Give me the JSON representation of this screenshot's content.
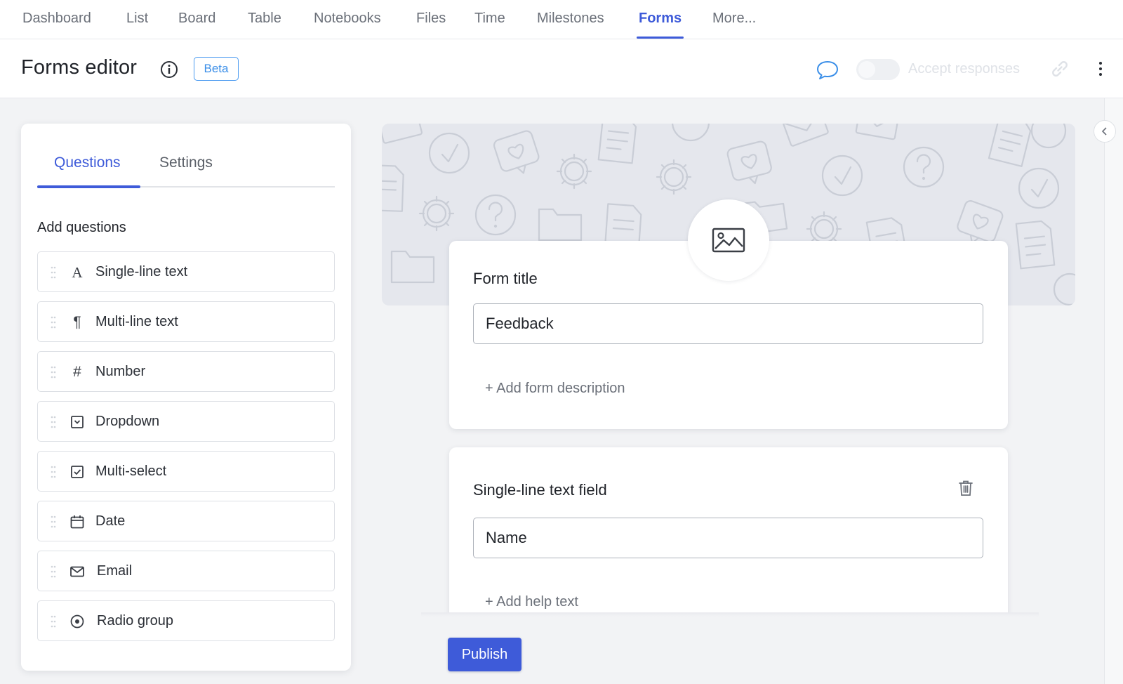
{
  "nav": {
    "tabs": [
      {
        "label": "Dashboard"
      },
      {
        "label": "List"
      },
      {
        "label": "Board"
      },
      {
        "label": "Table"
      },
      {
        "label": "Notebooks"
      },
      {
        "label": "Files"
      },
      {
        "label": "Time"
      },
      {
        "label": "Milestones"
      },
      {
        "label": "Forms",
        "active": true
      },
      {
        "label": "More..."
      }
    ]
  },
  "header": {
    "title": "Forms editor",
    "badge": "Beta",
    "accept_responses_label": "Accept responses",
    "accept_responses_on": false
  },
  "panel": {
    "tabs": [
      {
        "label": "Questions",
        "active": true
      },
      {
        "label": "Settings"
      }
    ],
    "heading": "Add questions",
    "question_types": [
      {
        "label": "Single-line text",
        "icon": "text-a-icon"
      },
      {
        "label": "Multi-line text",
        "icon": "paragraph-icon"
      },
      {
        "label": "Number",
        "icon": "hash-icon"
      },
      {
        "label": "Dropdown",
        "icon": "dropdown-icon"
      },
      {
        "label": "Multi-select",
        "icon": "checkbox-icon"
      },
      {
        "label": "Date",
        "icon": "calendar-icon"
      },
      {
        "label": "Email",
        "icon": "envelope-icon"
      },
      {
        "label": "Radio group",
        "icon": "radio-icon"
      }
    ]
  },
  "form": {
    "title_label": "Form title",
    "title_value": "Feedback",
    "add_description": "+ Add form description",
    "fields": [
      {
        "label": "Single-line text field",
        "value": "Name",
        "add_help": "+ Add help text"
      }
    ]
  },
  "actions": {
    "publish": "Publish"
  },
  "colors": {
    "accent": "#3e5bd9",
    "badge": "#3a8ee8",
    "background": "#f2f3f5"
  }
}
